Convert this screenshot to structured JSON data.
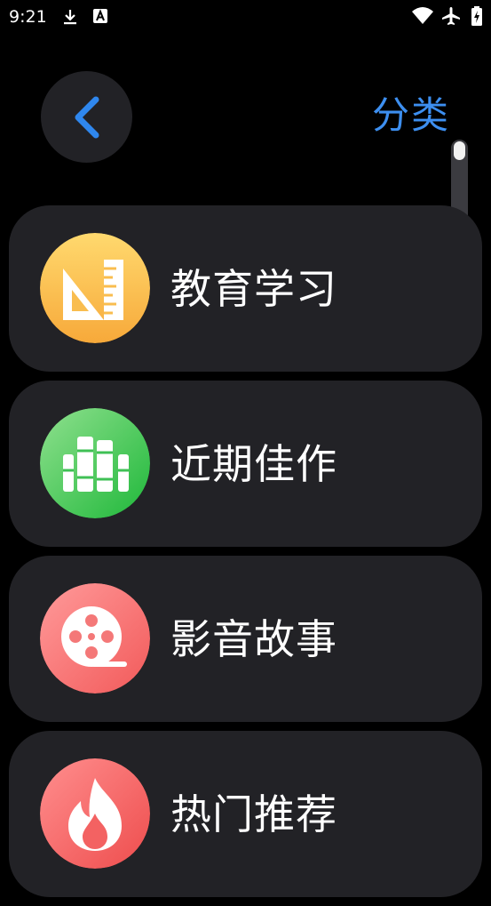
{
  "status_bar": {
    "time": "9:21",
    "left_icons": [
      "download-icon",
      "a-badge-icon"
    ],
    "right_icons": [
      "wifi-icon",
      "airplane-icon",
      "battery-icon"
    ]
  },
  "header": {
    "back_icon": "chevron-left-icon",
    "title": "分类"
  },
  "categories": [
    {
      "label": "教育学习",
      "icon": "ruler-triangle-icon",
      "color": "#fbbd4e"
    },
    {
      "label": "近期佳作",
      "icon": "books-icon",
      "color": "#34c54e"
    },
    {
      "label": "影音故事",
      "icon": "film-reel-icon",
      "color": "#f36c6c"
    },
    {
      "label": "热门推荐",
      "icon": "flame-icon",
      "color": "#f25f5f"
    }
  ],
  "colors": {
    "background": "#000000",
    "card": "#222226",
    "accent": "#3d8ff0"
  }
}
